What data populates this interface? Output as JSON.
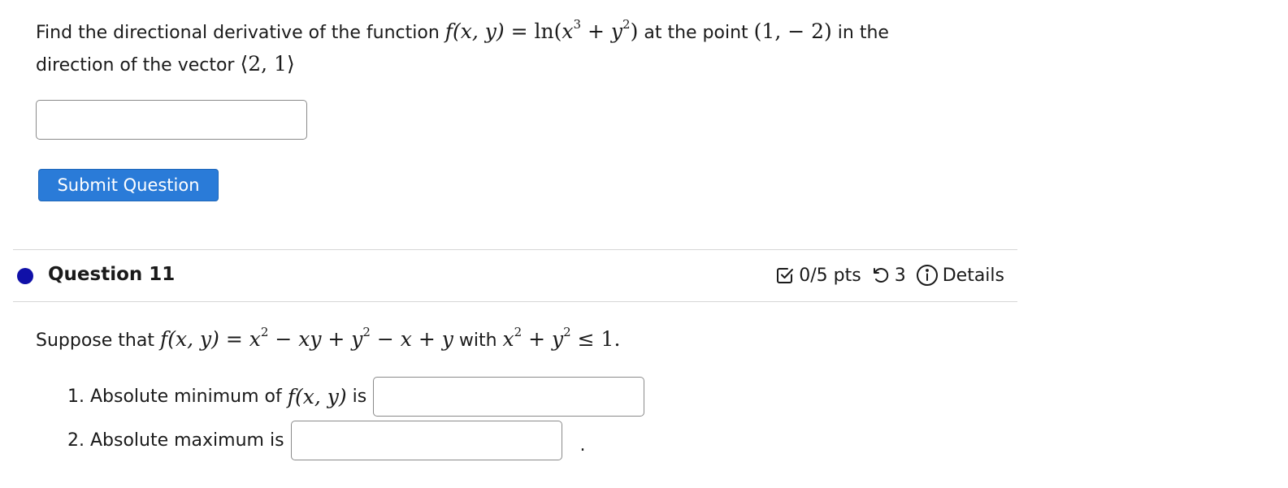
{
  "previous_question": {
    "prompt_text_1": "Find the directional derivative of the function",
    "function_lhs": "f(x, y)",
    "equals": "=",
    "ln": "ln",
    "expr_open": "(",
    "x_base": "x",
    "x_exp": "3",
    "plus": "+",
    "y_base": "y",
    "y_exp": "2",
    "expr_close": ")",
    "prompt_text_2": "at the point",
    "point": "(1,  − 2)",
    "prompt_text_3": "in the",
    "prompt_text_4": "direction of the vector",
    "vector": "⟨2, 1⟩",
    "answer_value": "",
    "submit_label": "Submit Question"
  },
  "question": {
    "title": "Question 11",
    "points": "0/5 pts",
    "attempts": "3",
    "details_label": "Details",
    "dot_color": "#1010a8",
    "icons": {
      "points": "checkbox-check-icon",
      "attempts": "undo-icon",
      "details": "info-circle-icon"
    },
    "intro_text": "Suppose that",
    "function_lhs": "f(x, y)",
    "equals": "=",
    "term_x": "x",
    "term_x_exp": "2",
    "term_xy": " − xy + ",
    "term_y": "y",
    "term_y_exp": "2",
    "term_rest": " − x + y",
    "with_text": "with",
    "constraint_x": "x",
    "constraint_x_exp": "2",
    "constraint_plus": " + ",
    "constraint_y": "y",
    "constraint_y_exp": "2",
    "constraint_rest": " ≤ 1.",
    "part1_label": "1. Absolute minimum of",
    "part1_fn": "f(x, y)",
    "part1_is": "is",
    "part1_value": "",
    "part2_label": "2. Absolute maximum is",
    "part2_value": "",
    "part2_trailing": "."
  },
  "colors": {
    "submit_button": "#2a7bd8",
    "divider": "#d6d6d6"
  }
}
